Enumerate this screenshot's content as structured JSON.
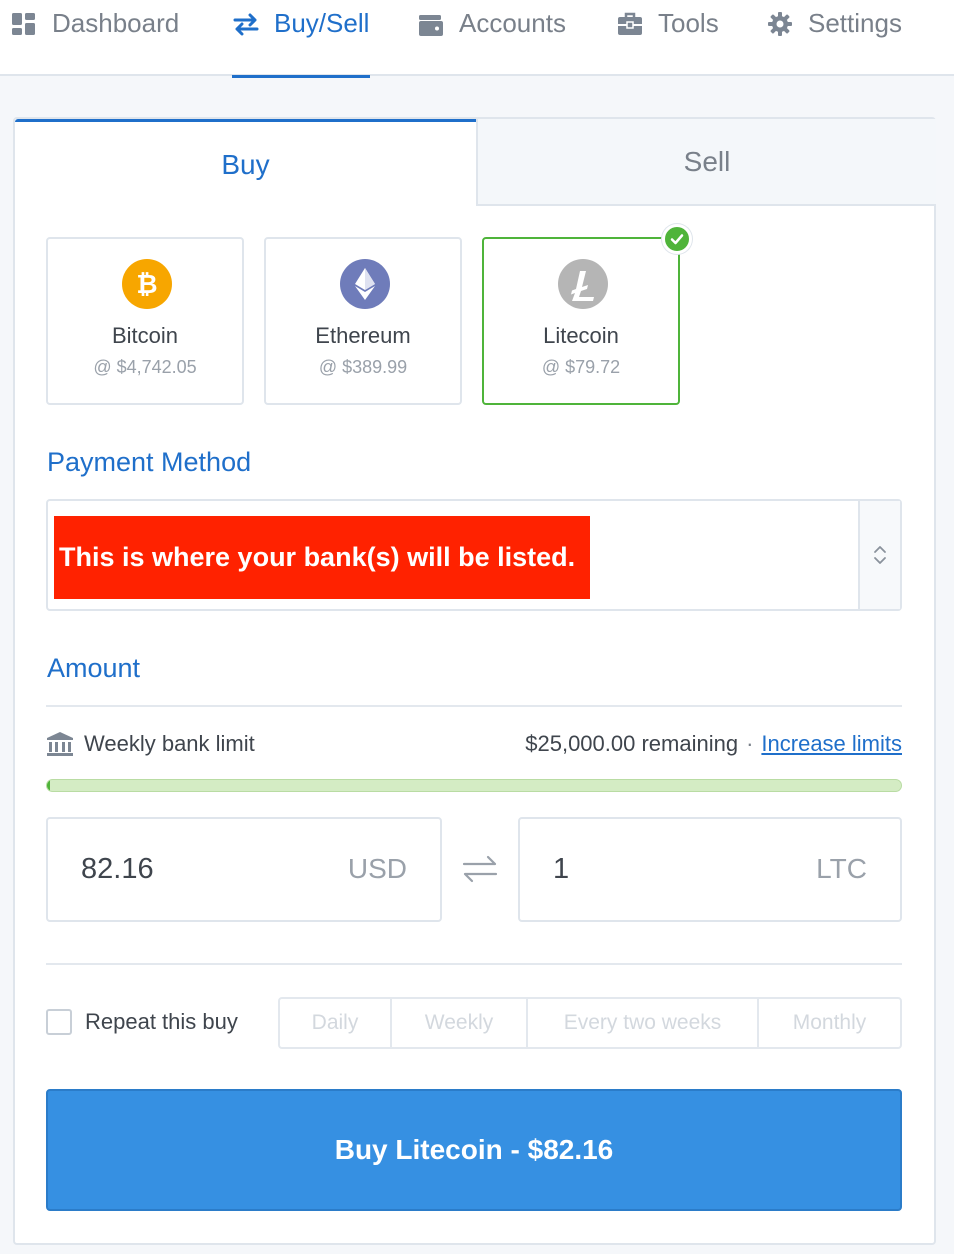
{
  "nav": {
    "dashboard": "Dashboard",
    "buysell": "Buy/Sell",
    "accounts": "Accounts",
    "tools": "Tools",
    "settings": "Settings"
  },
  "tabs": {
    "buy": "Buy",
    "sell": "Sell"
  },
  "coins": [
    {
      "name": "Bitcoin",
      "price": "@ $4,742.05",
      "color": "#f7a600",
      "icon": "bitcoin-icon"
    },
    {
      "name": "Ethereum",
      "price": "@ $389.99",
      "color": "#6f7cba",
      "icon": "ethereum-icon"
    },
    {
      "name": "Litecoin",
      "price": "@ $79.72",
      "color": "#b5b5b5",
      "icon": "litecoin-icon",
      "selected": true
    }
  ],
  "payment": {
    "title": "Payment Method",
    "banner": "This is where your bank(s) will be listed."
  },
  "amount": {
    "title": "Amount",
    "limit_label": "Weekly bank limit",
    "remaining": "$25,000.00 remaining",
    "separator": "·",
    "increase_link": "Increase limits",
    "limit_used_fraction": 0.003,
    "usd_value": "82.16",
    "usd_unit": "USD",
    "crypto_value": "1",
    "crypto_unit": "LTC"
  },
  "repeat": {
    "label": "Repeat this buy",
    "options": [
      "Daily",
      "Weekly",
      "Every two weeks",
      "Monthly"
    ]
  },
  "buy_button": "Buy Litecoin - $82.16",
  "colors": {
    "accent": "#1f6fca",
    "success": "#4fb43a",
    "button": "#3690e2",
    "banner": "#ff2200"
  }
}
